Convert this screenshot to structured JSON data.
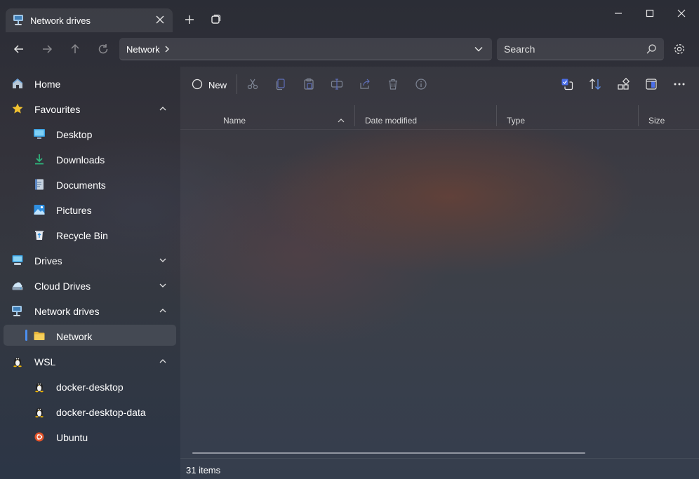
{
  "window": {
    "tab_title": "Network drives",
    "colors": {
      "accent": "#4c8ff0",
      "folder": "#f2c94c"
    }
  },
  "address_bar": {
    "breadcrumb": [
      "Network"
    ]
  },
  "search": {
    "placeholder": "Search"
  },
  "sidebar": {
    "items": [
      {
        "label": "Home",
        "icon": "home-icon"
      },
      {
        "label": "Favourites",
        "icon": "star-icon",
        "expanded": true
      },
      {
        "label": "Desktop",
        "icon": "desktop-icon"
      },
      {
        "label": "Downloads",
        "icon": "download-icon"
      },
      {
        "label": "Documents",
        "icon": "document-icon"
      },
      {
        "label": "Pictures",
        "icon": "pictures-icon"
      },
      {
        "label": "Recycle Bin",
        "icon": "recycle-bin-icon"
      },
      {
        "label": "Drives",
        "icon": "drive-icon",
        "expanded": false
      },
      {
        "label": "Cloud Drives",
        "icon": "cloud-drive-icon",
        "expanded": false
      },
      {
        "label": "Network drives",
        "icon": "network-drive-icon",
        "expanded": true
      },
      {
        "label": "Network",
        "icon": "folder-icon",
        "selected": true
      },
      {
        "label": "WSL",
        "icon": "linux-icon",
        "expanded": true
      },
      {
        "label": "docker-desktop",
        "icon": "linux-icon"
      },
      {
        "label": "docker-desktop-data",
        "icon": "linux-icon"
      },
      {
        "label": "Ubuntu",
        "icon": "ubuntu-icon"
      }
    ]
  },
  "toolbar": {
    "new_label": "New",
    "actions": [
      "cut-icon",
      "copy-icon",
      "paste-icon",
      "rename-icon",
      "share-icon",
      "delete-icon",
      "properties-icon"
    ],
    "right_actions": [
      "selection-options-icon",
      "sort-icon",
      "group-icon",
      "layout-icon",
      "more-icon"
    ]
  },
  "columns": [
    "Name",
    "Date modified",
    "Type",
    "Size"
  ],
  "status": {
    "item_count": "31 items"
  }
}
